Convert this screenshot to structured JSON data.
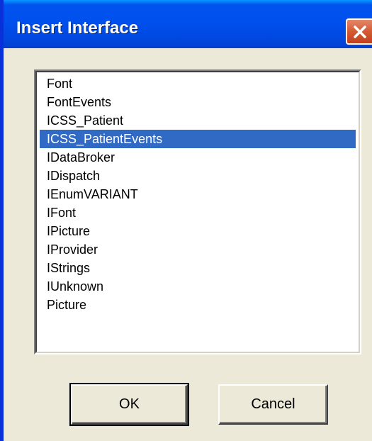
{
  "window": {
    "title": "Insert Interface"
  },
  "interfaces": {
    "items": [
      "Font",
      "FontEvents",
      "ICSS_Patient",
      "ICSS_PatientEvents",
      "IDataBroker",
      "IDispatch",
      "IEnumVARIANT",
      "IFont",
      "IPicture",
      "IProvider",
      "IStrings",
      "IUnknown",
      "Picture"
    ],
    "selected_index": 3,
    "selected_value": "ICSS_PatientEvents"
  },
  "buttons": {
    "ok_label": "OK",
    "cancel_label": "Cancel"
  },
  "icons": {
    "close": "close-icon"
  },
  "colors": {
    "titlebar": "#0053ee",
    "selection": "#316ac5",
    "dialog_face": "#ece9d8",
    "close_button": "#d45a33"
  }
}
